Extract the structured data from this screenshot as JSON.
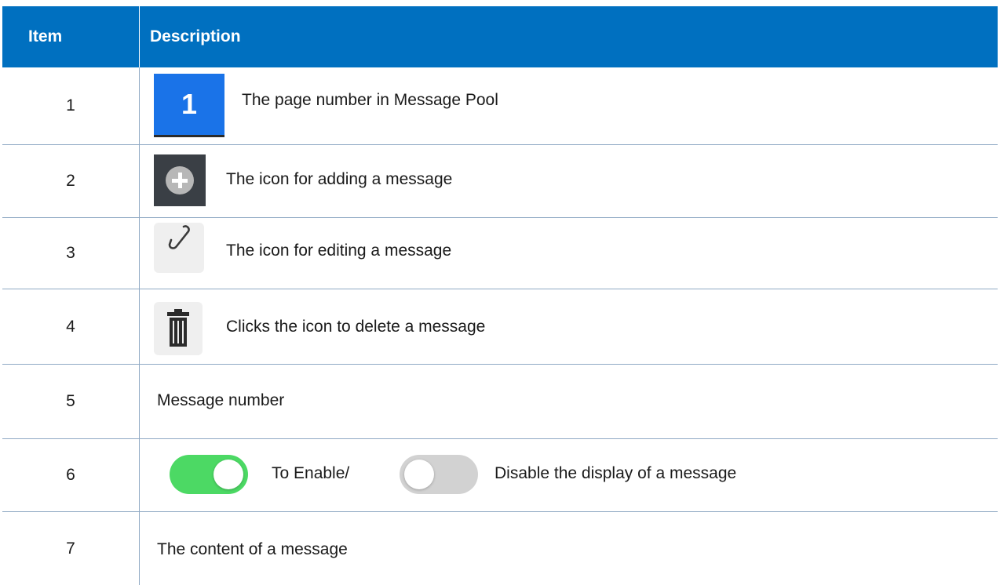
{
  "header": {
    "item": "Item",
    "description": "Description"
  },
  "rows": [
    {
      "item": "1",
      "description": "The page number in Message Pool",
      "badge": "1"
    },
    {
      "item": "2",
      "description": "The icon for adding a message"
    },
    {
      "item": "3",
      "description": "The icon for editing a message"
    },
    {
      "item": "4",
      "description": "Clicks the icon to delete a message"
    },
    {
      "item": "5",
      "description": "Message number"
    },
    {
      "item": "6",
      "description_a": "To Enable/",
      "description_b": "Disable the display of a message"
    },
    {
      "item": "7",
      "description": "The content of a message"
    }
  ],
  "icons": [
    "add-icon",
    "edit-icon",
    "delete-icon",
    "toggle-on-icon",
    "toggle-off-icon"
  ],
  "colors": {
    "header_bg": "#0070c0",
    "badge_bg": "#1a73e8",
    "toggle_on": "#4cd964",
    "toggle_off": "#d2d2d2"
  }
}
